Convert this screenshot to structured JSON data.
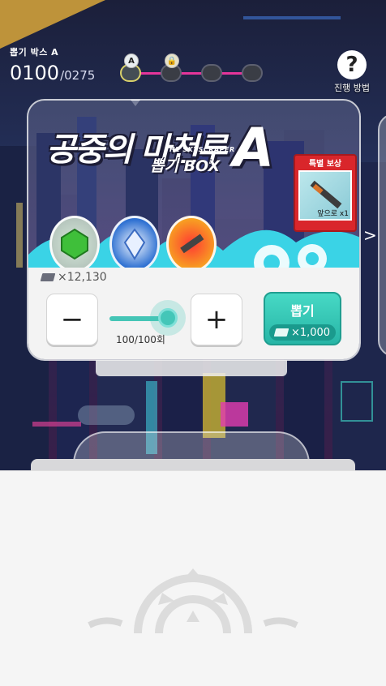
{
  "box": {
    "name": "뽑기 박스 A",
    "count_current": "0100",
    "count_sep": "/",
    "count_max": "0275"
  },
  "stages": [
    {
      "badge": "A",
      "state": "active"
    },
    {
      "badge": "lock",
      "state": "locked"
    },
    {
      "badge": "",
      "state": "empty"
    },
    {
      "badge": "",
      "state": "empty"
    }
  ],
  "help": {
    "label": "진행 방법",
    "icon": "?"
  },
  "banner": {
    "title_main": "공중의 마천루",
    "title_sub": "THE SKYSCRAPER",
    "title_box": "뽑기 BOX",
    "title_letter": "A"
  },
  "special_reward": {
    "title": "특별 보상",
    "qty": "앞으로 x1"
  },
  "cost": {
    "ticket_text": "×12,130"
  },
  "quantity": {
    "minus_label": "−",
    "plus_label": "+",
    "label": "100/100회",
    "value_fraction": 1.0
  },
  "draw": {
    "label": "뽑기",
    "cost": "×1,000"
  },
  "colors": {
    "accent_teal": "#44c6b8",
    "special_red": "#d9262b",
    "stage_line": "#e5359a",
    "corner_gold": "#c79a3a"
  }
}
